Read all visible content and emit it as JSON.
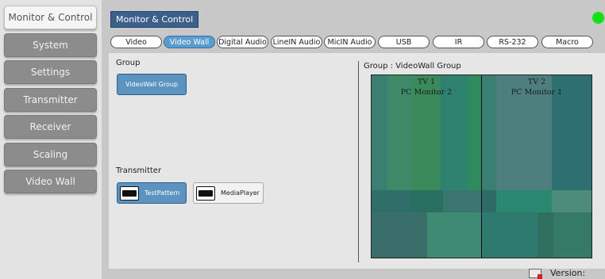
{
  "sidebar": {
    "items": [
      {
        "label": "Monitor & Control",
        "active": true
      },
      {
        "label": "System"
      },
      {
        "label": "Settings"
      },
      {
        "label": "Transmitter"
      },
      {
        "label": "Receiver"
      },
      {
        "label": "Scaling"
      },
      {
        "label": "Video Wall"
      }
    ]
  },
  "header": {
    "title": "Monitor & Control",
    "status_color": "#14e014"
  },
  "tabs": [
    {
      "label": "Video"
    },
    {
      "label": "Video Wall",
      "active": true
    },
    {
      "label": "Digital Audio"
    },
    {
      "label": "LineIN Audio"
    },
    {
      "label": "MicIN Audio"
    },
    {
      "label": "USB"
    },
    {
      "label": "IR"
    },
    {
      "label": "RS-232"
    },
    {
      "label": "Macro"
    }
  ],
  "group_section": {
    "label": "Group",
    "groups": [
      "VideoWall Group"
    ]
  },
  "transmitter_section": {
    "label": "Transmitter",
    "items": [
      {
        "name": "TestPattern",
        "active": true,
        "icon": "projector-icon"
      },
      {
        "name": "MediaPlayer",
        "active": false,
        "icon": "projector-icon"
      }
    ]
  },
  "wall": {
    "title": "Group : VideoWall Group",
    "screens": [
      {
        "tv": "TV 1",
        "source": "PC Monitor 2"
      },
      {
        "tv": "TV 2",
        "source": "PC Monitor 1"
      }
    ]
  },
  "footer": {
    "version_label": "Version:",
    "icon": "keyboard-icon"
  },
  "colors": {
    "accent": "#5b9ccf",
    "header": "#3d5f8c",
    "wall": "#2f7a6e"
  }
}
